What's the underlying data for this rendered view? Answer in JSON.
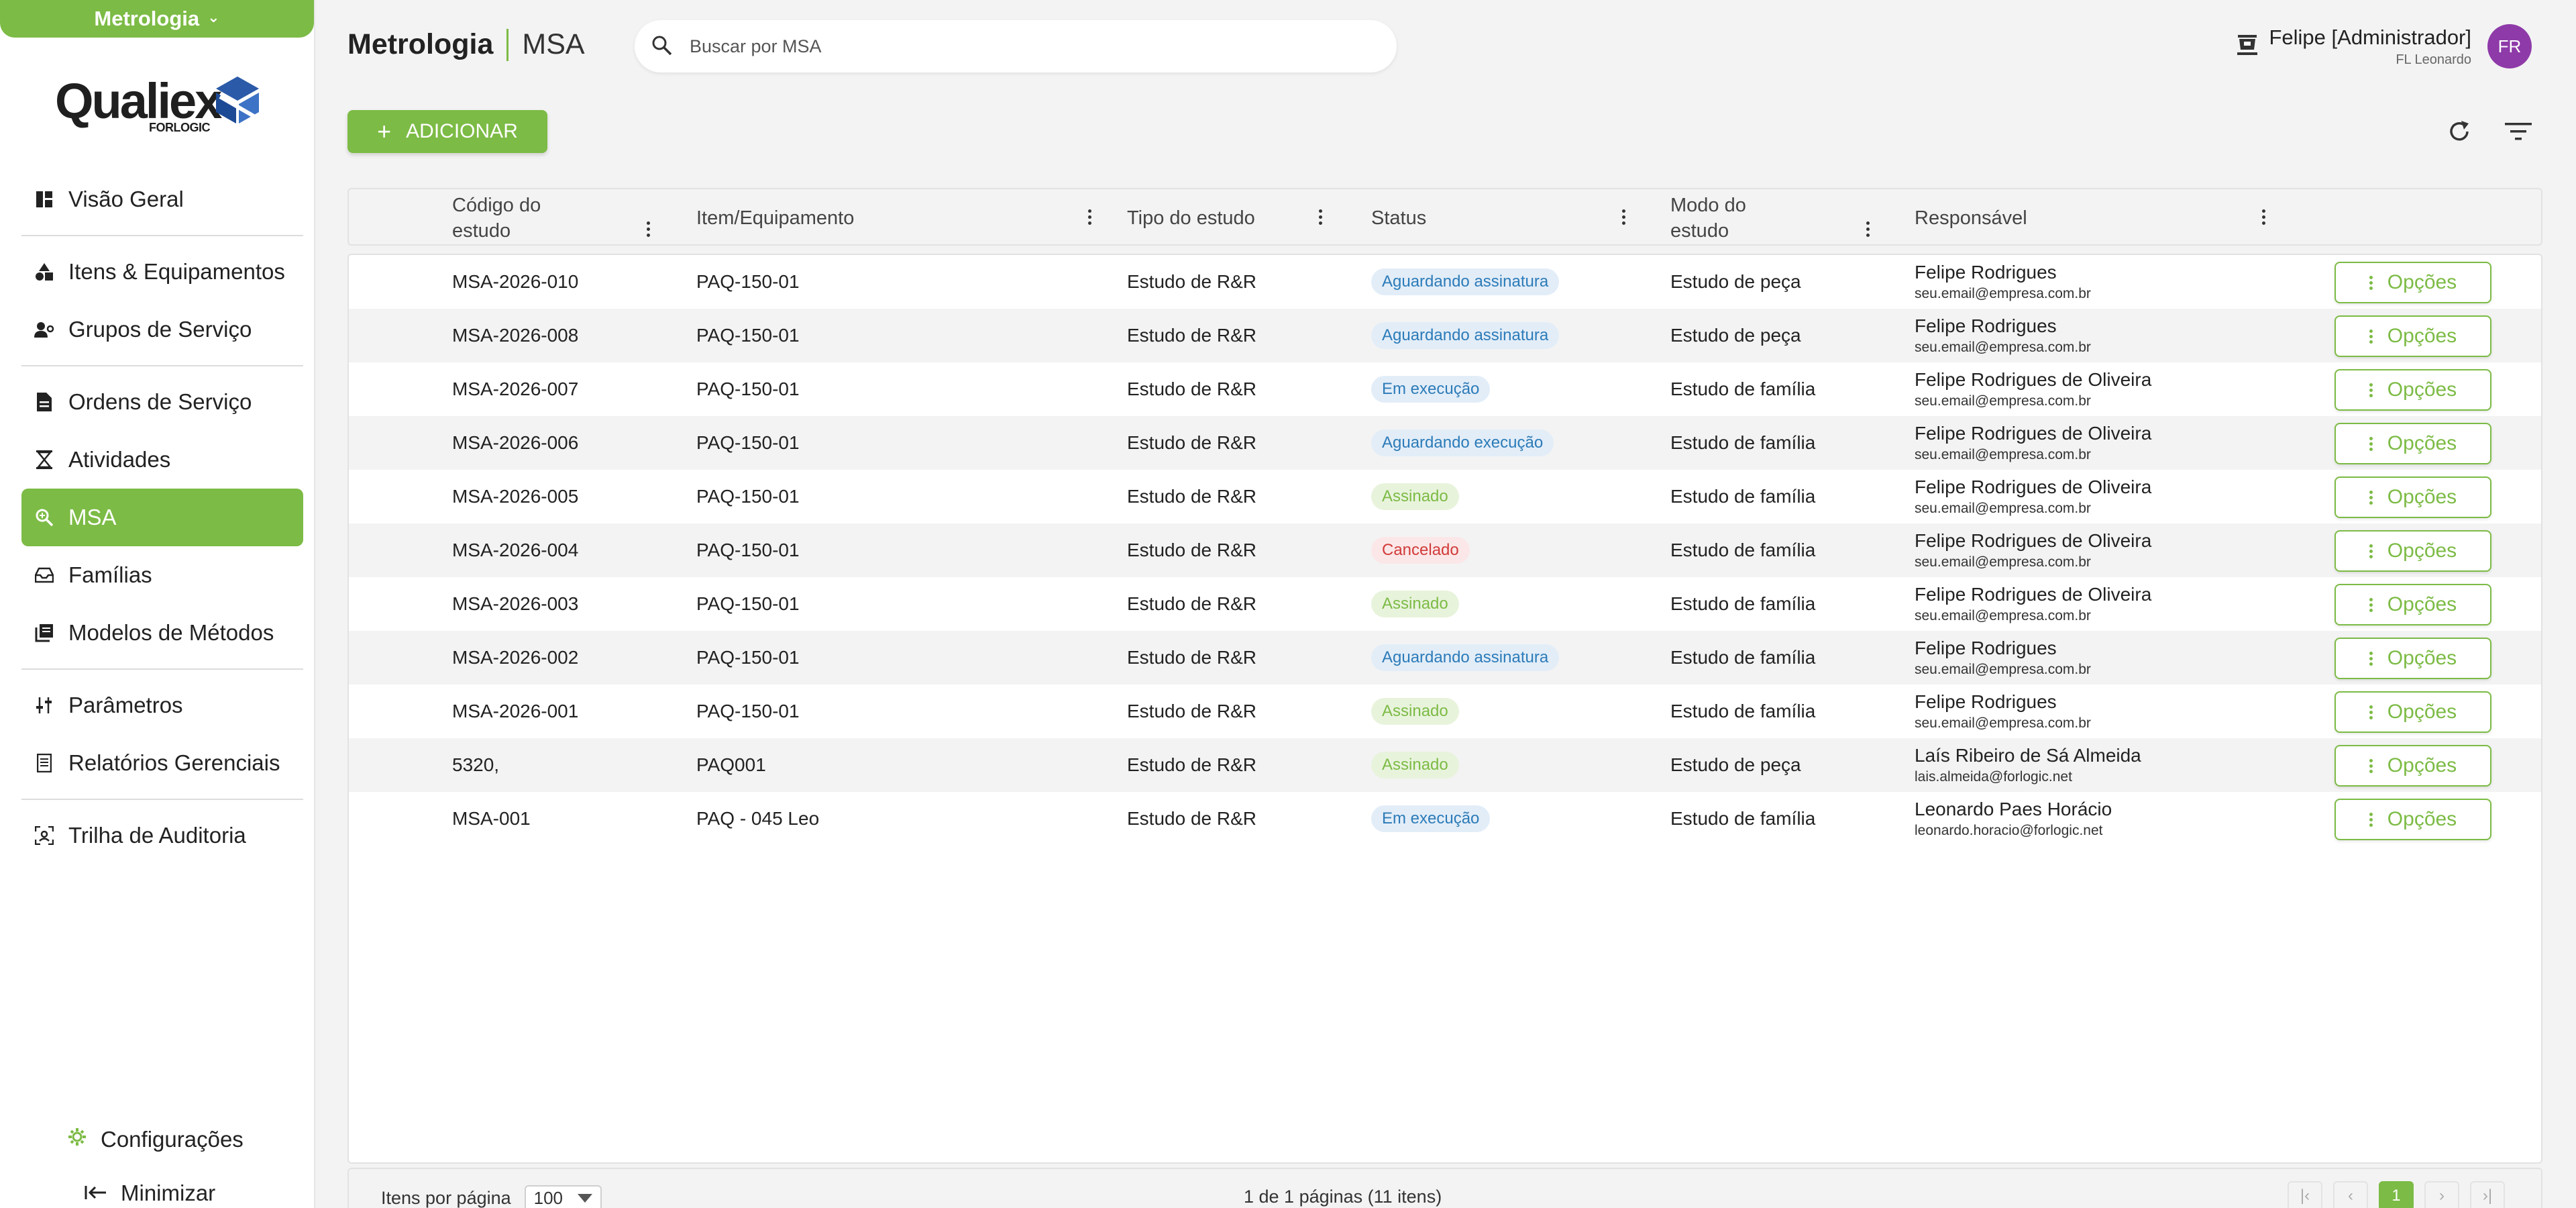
{
  "sidebar": {
    "module": "Metrologia",
    "logo_word": "Qualiex",
    "logo_sub": "FORLOGIC",
    "items": [
      {
        "label": "Visão Geral"
      },
      {
        "label": "Itens & Equipamentos"
      },
      {
        "label": "Grupos de Serviço"
      },
      {
        "label": "Ordens de Serviço"
      },
      {
        "label": "Atividades"
      },
      {
        "label": "MSA",
        "active": true
      },
      {
        "label": "Famílias"
      },
      {
        "label": "Modelos de Métodos"
      },
      {
        "label": "Parâmetros"
      },
      {
        "label": "Relatórios Gerenciais"
      },
      {
        "label": "Trilha de Auditoria"
      }
    ],
    "settings_label": "Configurações",
    "minimize_label": "Minimizar"
  },
  "header": {
    "module": "Metrologia",
    "page": "MSA",
    "search_placeholder": "Buscar por MSA",
    "user_name": "Felipe [Administrador]",
    "user_sub": "FL Leonardo",
    "avatar_initials": "FR"
  },
  "toolbar": {
    "add_label": "ADICIONAR"
  },
  "table": {
    "columns": {
      "code": "Código do estudo",
      "item": "Item/Equipamento",
      "type": "Tipo do estudo",
      "status": "Status",
      "mode": "Modo do estudo",
      "resp": "Responsável"
    },
    "option_label": "Opções",
    "rows": [
      {
        "code": "MSA-2026-010",
        "item": "PAQ-150-01",
        "type": "Estudo de R&R",
        "status": "Aguardando assinatura",
        "mode": "Estudo de peça",
        "resp_name": "Felipe Rodrigues",
        "resp_email": "seu.email@empresa.com.br"
      },
      {
        "code": "MSA-2026-008",
        "item": "PAQ-150-01",
        "type": "Estudo de R&R",
        "status": "Aguardando assinatura",
        "mode": "Estudo de peça",
        "resp_name": "Felipe Rodrigues",
        "resp_email": "seu.email@empresa.com.br"
      },
      {
        "code": "MSA-2026-007",
        "item": "PAQ-150-01",
        "type": "Estudo de R&R",
        "status": "Em execução",
        "mode": "Estudo de família",
        "resp_name": "Felipe Rodrigues de Oliveira",
        "resp_email": "seu.email@empresa.com.br"
      },
      {
        "code": "MSA-2026-006",
        "item": "PAQ-150-01",
        "type": "Estudo de R&R",
        "status": "Aguardando execução",
        "mode": "Estudo de família",
        "resp_name": "Felipe Rodrigues de Oliveira",
        "resp_email": "seu.email@empresa.com.br"
      },
      {
        "code": "MSA-2026-005",
        "item": "PAQ-150-01",
        "type": "Estudo de R&R",
        "status": "Assinado",
        "mode": "Estudo de família",
        "resp_name": "Felipe Rodrigues de Oliveira",
        "resp_email": "seu.email@empresa.com.br"
      },
      {
        "code": "MSA-2026-004",
        "item": "PAQ-150-01",
        "type": "Estudo de R&R",
        "status": "Cancelado",
        "mode": "Estudo de família",
        "resp_name": "Felipe Rodrigues de Oliveira",
        "resp_email": "seu.email@empresa.com.br"
      },
      {
        "code": "MSA-2026-003",
        "item": "PAQ-150-01",
        "type": "Estudo de R&R",
        "status": "Assinado",
        "mode": "Estudo de família",
        "resp_name": "Felipe Rodrigues de Oliveira",
        "resp_email": "seu.email@empresa.com.br"
      },
      {
        "code": "MSA-2026-002",
        "item": "PAQ-150-01",
        "type": "Estudo de R&R",
        "status": "Aguardando assinatura",
        "mode": "Estudo de família",
        "resp_name": "Felipe Rodrigues",
        "resp_email": "seu.email@empresa.com.br"
      },
      {
        "code": "MSA-2026-001",
        "item": "PAQ-150-01",
        "type": "Estudo de R&R",
        "status": "Assinado",
        "mode": "Estudo de família",
        "resp_name": "Felipe Rodrigues",
        "resp_email": "seu.email@empresa.com.br"
      },
      {
        "code": "5320,",
        "item": "PAQ001",
        "type": "Estudo de R&R",
        "status": "Assinado",
        "mode": "Estudo de peça",
        "resp_name": "Laís Ribeiro de Sá Almeida",
        "resp_email": "lais.almeida@forlogic.net"
      },
      {
        "code": "MSA-001",
        "item": "PAQ - 045 Leo",
        "type": "Estudo de R&R",
        "status": "Em execução",
        "mode": "Estudo de família",
        "resp_name": "Leonardo Paes Horácio",
        "resp_email": "leonardo.horacio@forlogic.net"
      }
    ]
  },
  "status_colors": {
    "Aguardando assinatura": "blue",
    "Aguardando execução": "blue",
    "Em execução": "blue",
    "Assinado": "green",
    "Cancelado": "red"
  },
  "footer": {
    "items_per_page_label": "Itens por página",
    "items_per_page": "100",
    "page_info": "1 de 1 páginas (11 itens)",
    "current_page": "1"
  },
  "colors": {
    "accent": "#7cbb45",
    "avatar": "#8e3aa8"
  }
}
